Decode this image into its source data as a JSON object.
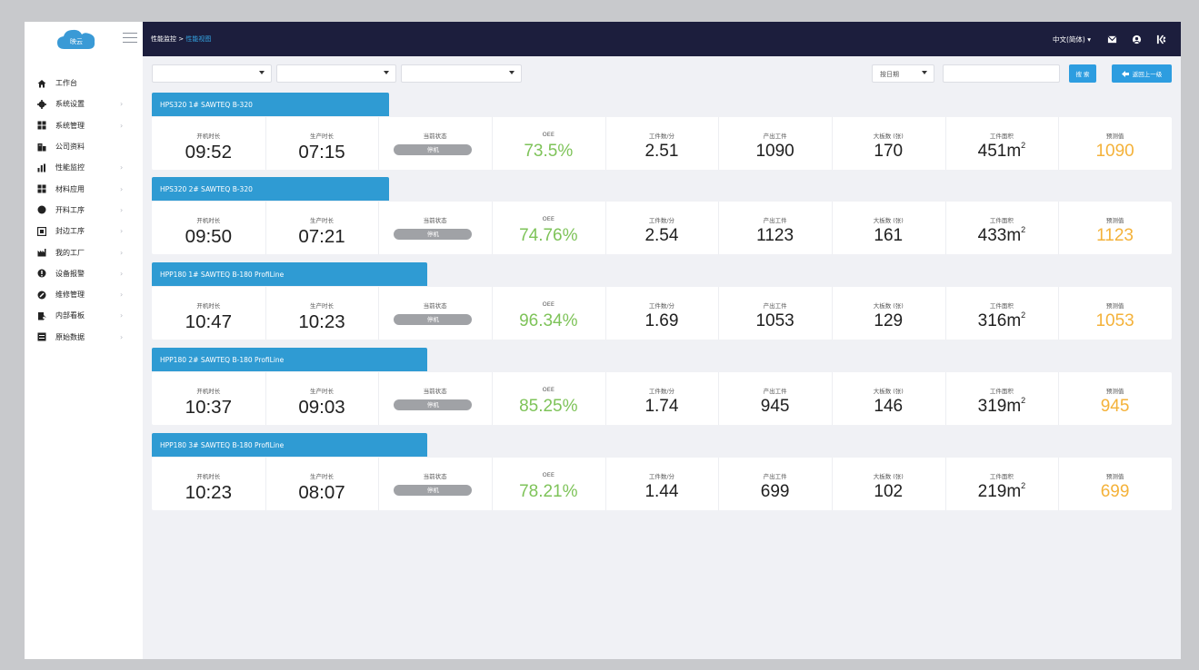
{
  "sidebar": {
    "logo_text": "映云",
    "items": [
      {
        "label": "工作台",
        "icon": "home-icon",
        "has_chevron": false
      },
      {
        "label": "系统设置",
        "icon": "gear-icon",
        "has_chevron": true
      },
      {
        "label": "系统管理",
        "icon": "grid-icon",
        "has_chevron": true
      },
      {
        "label": "公司资料",
        "icon": "building-icon",
        "has_chevron": false
      },
      {
        "label": "性能监控",
        "icon": "bar-chart-icon",
        "has_chevron": true
      },
      {
        "label": "材料应用",
        "icon": "grid-icon",
        "has_chevron": true
      },
      {
        "label": "开料工序",
        "icon": "circle-icon",
        "has_chevron": true
      },
      {
        "label": "封边工序",
        "icon": "square-icon",
        "has_chevron": true
      },
      {
        "label": "我的工厂",
        "icon": "factory-icon",
        "has_chevron": true
      },
      {
        "label": "设备报警",
        "icon": "alert-icon",
        "has_chevron": true
      },
      {
        "label": "维修管理",
        "icon": "wrench-icon",
        "has_chevron": true
      },
      {
        "label": "内部看板",
        "icon": "board-icon",
        "has_chevron": true
      },
      {
        "label": "原始数据",
        "icon": "list-icon",
        "has_chevron": true
      }
    ],
    "chevron": "›"
  },
  "header": {
    "breadcrumb_root": "性能监控 > ",
    "breadcrumb_current": "性能视图",
    "language": "中文(简体) ▾"
  },
  "filters": {
    "date_select": "按日期",
    "search_button": "搜 索",
    "back_button": "返回上一级"
  },
  "colors": {
    "topbar": "#1c1e3d",
    "accent": "#2f9bd3",
    "oee_green": "#7ec359",
    "forecast_orange": "#f4b23a",
    "status_gray": "#a0a2a6"
  },
  "labels": {
    "on_time": "开机时长",
    "prod_time": "生产时长",
    "status": "当前状态",
    "oee": "OEE",
    "pieces_per_min": "工件数/分",
    "output": "产出工件",
    "boards": "大板数 (张)",
    "area": "工件面积",
    "forecast": "预测值"
  },
  "machines": [
    {
      "name": "HPS320 1#    SAWTEQ B-320",
      "on_time": "09:52",
      "prod_time": "07:15",
      "status": "停机",
      "oee": "73.5%",
      "pieces_per_min": "2.51",
      "output": "1090",
      "boards": "170",
      "area": "451m",
      "forecast": "1090"
    },
    {
      "name": "HPS320 2#    SAWTEQ B-320",
      "on_time": "09:50",
      "prod_time": "07:21",
      "status": "停机",
      "oee": "74.76%",
      "pieces_per_min": "2.54",
      "output": "1123",
      "boards": "161",
      "area": "433m",
      "forecast": "1123"
    },
    {
      "name": "HPP180 1#    SAWTEQ B-180 ProfiLine",
      "on_time": "10:47",
      "prod_time": "10:23",
      "status": "停机",
      "oee": "96.34%",
      "pieces_per_min": "1.69",
      "output": "1053",
      "boards": "129",
      "area": "316m",
      "forecast": "1053"
    },
    {
      "name": "HPP180 2#    SAWTEQ B-180 ProfiLine",
      "on_time": "10:37",
      "prod_time": "09:03",
      "status": "停机",
      "oee": "85.25%",
      "pieces_per_min": "1.74",
      "output": "945",
      "boards": "146",
      "area": "319m",
      "forecast": "945"
    },
    {
      "name": "HPP180 3#    SAWTEQ B-180 ProfiLine",
      "on_time": "10:23",
      "prod_time": "08:07",
      "status": "停机",
      "oee": "78.21%",
      "pieces_per_min": "1.44",
      "output": "699",
      "boards": "102",
      "area": "219m",
      "forecast": "699"
    }
  ],
  "area_unit_sup": "2"
}
